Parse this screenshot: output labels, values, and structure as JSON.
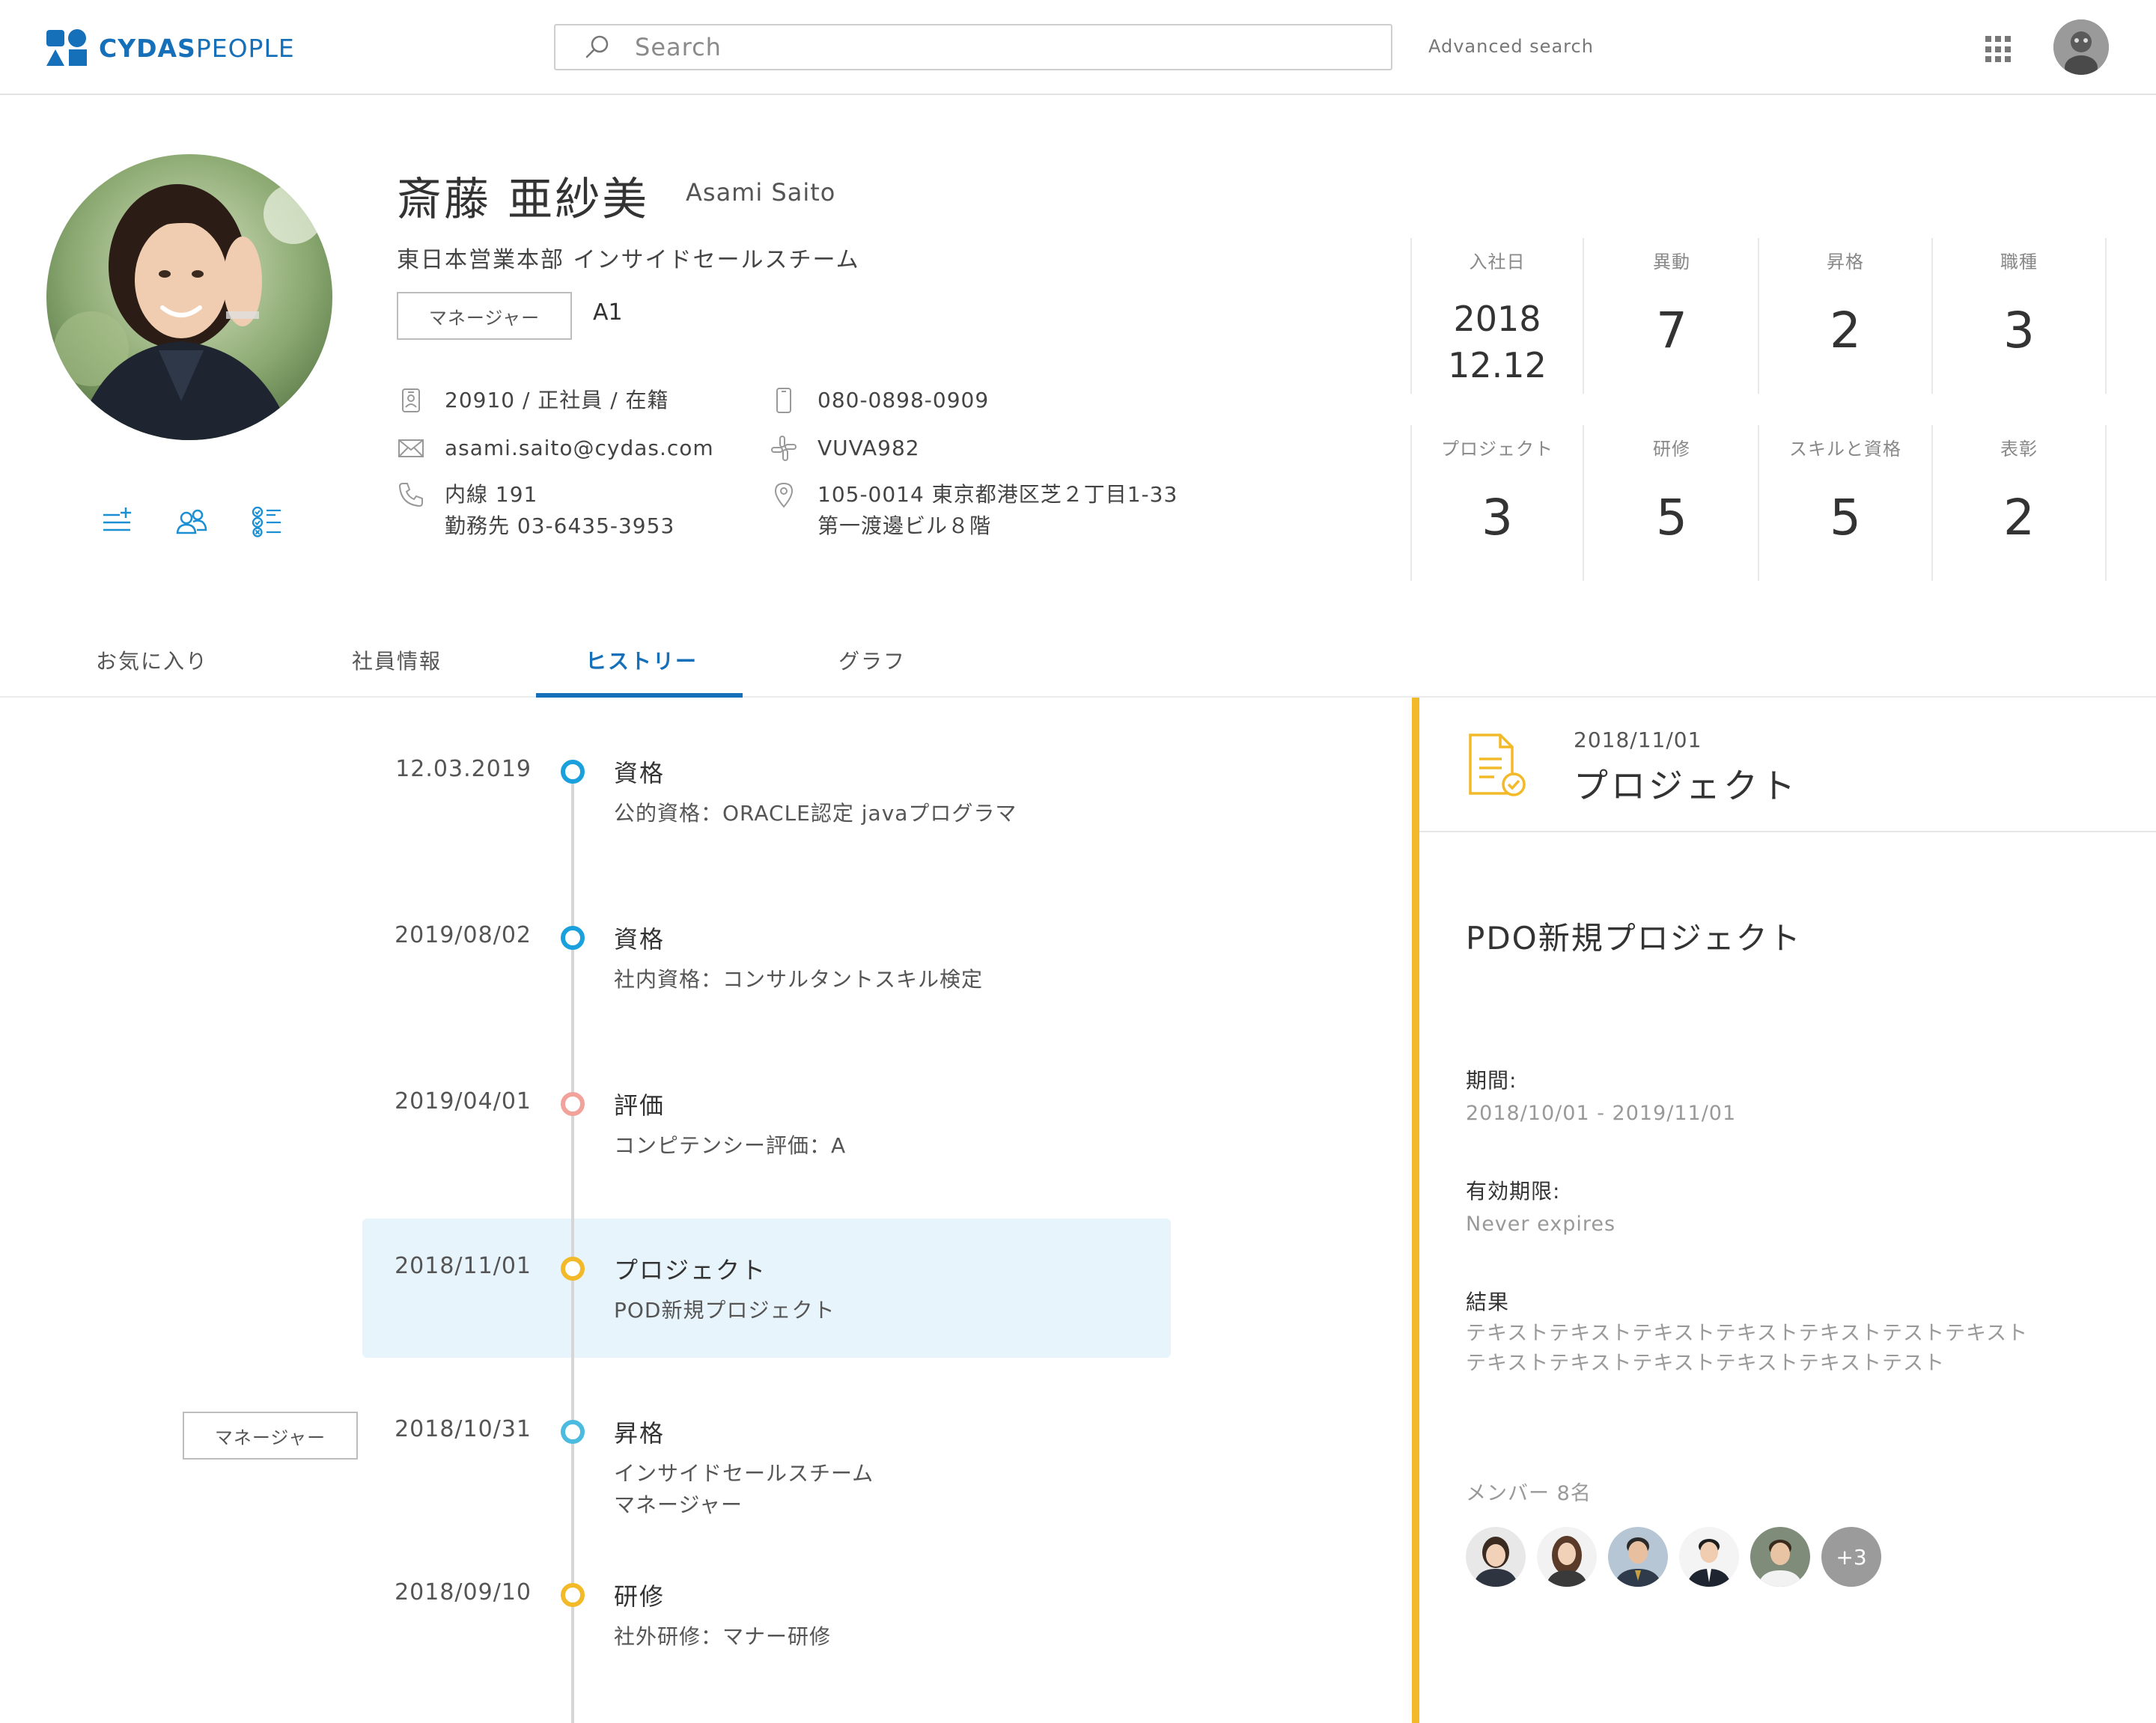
{
  "header": {
    "logo_bold": "CYDAS",
    "logo_light": "PEOPLE",
    "search_placeholder": "Search",
    "advanced_search": "Advanced search"
  },
  "profile": {
    "name_jp": "斎藤 亜紗美",
    "name_en": "Asami Saito",
    "department": "東日本営業本部  インサイドセールスチーム",
    "role": "マネージャー",
    "grade": "A1",
    "employee_info": "20910 / 正社員 / 在籍",
    "email": "asami.saito@cydas.com",
    "extension": "内線 191",
    "office_phone": "勤務先 03-6435-3953",
    "mobile": "080-0898-0909",
    "slack_id": "VUVA982",
    "address_line1": "105-0014 東京都港区芝２丁目1-33",
    "address_line2": "第一渡邊ビル８階"
  },
  "stats": {
    "join_label": "入社日",
    "join_year": "2018",
    "join_day": "12.12",
    "transfer_label": "異動",
    "transfer_value": "7",
    "promotion_label": "昇格",
    "promotion_value": "2",
    "jobtype_label": "職種",
    "jobtype_value": "3",
    "project_label": "プロジェクト",
    "project_value": "3",
    "training_label": "研修",
    "training_value": "5",
    "skill_label": "スキルと資格",
    "skill_value": "5",
    "award_label": "表彰",
    "award_value": "2"
  },
  "tabs": {
    "favorites": "お気に入り",
    "employee_info": "社員情報",
    "history": "ヒストリー",
    "graph": "グラフ"
  },
  "timeline": [
    {
      "date": "12.03.2019",
      "title": "資格",
      "desc1": "公的資格：ORACLE認定  javaプログラマ",
      "desc2": "",
      "color": "#1aa0dc"
    },
    {
      "date": "2019/08/02",
      "title": "資格",
      "desc1": "社内資格：コンサルタントスキル検定",
      "desc2": "",
      "color": "#1aa0dc"
    },
    {
      "date": "2019/04/01",
      "title": "評価",
      "desc1": "コンピテンシー評価：A",
      "desc2": "",
      "color": "#f0a29b"
    },
    {
      "date": "2018/11/01",
      "title": "プロジェクト",
      "desc1": "POD新規プロジェクト",
      "desc2": "",
      "color": "#f2b929"
    },
    {
      "date": "2018/10/31",
      "title": "昇格",
      "desc1": "インサイドセールスチーム",
      "desc2": "マネージャー",
      "color": "#4bbbe0",
      "badge": "マネージャー"
    },
    {
      "date": "2018/09/10",
      "title": "研修",
      "desc1": "社外研修：マナー研修",
      "desc2": "",
      "color": "#f2b929"
    }
  ],
  "panel": {
    "date": "2018/11/01",
    "type": "プロジェクト",
    "project_name": "PDO新規プロジェクト",
    "period_label": "期間:",
    "period_value": "2018/10/01 - 2019/11/01",
    "expiry_label": "有効期限:",
    "expiry_value": "Never expires",
    "result_label": "結果",
    "result_line1": "テキストテキストテキストテキストテキストテストテキスト",
    "result_line2": "テキストテキストテキストテキストテキストテスト",
    "members_label": "メンバー 8名",
    "members_more": "+3",
    "accent_color": "#f2b929"
  }
}
